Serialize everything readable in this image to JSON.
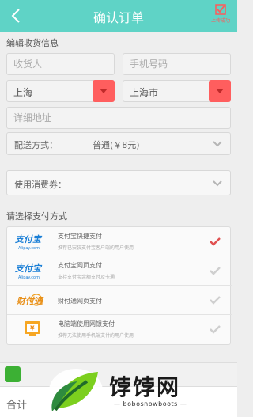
{
  "header": {
    "title": "确认订单",
    "upload_label": "上传成功"
  },
  "address": {
    "section_title": "编辑收货信息",
    "receiver_placeholder": "收货人",
    "phone_placeholder": "手机号码",
    "province": "上海",
    "city": "上海市",
    "detail_placeholder": "详细地址"
  },
  "delivery": {
    "label": "配送方式：",
    "value": "普通(￥8元)"
  },
  "voucher": {
    "label": "使用消费券："
  },
  "payment": {
    "section_title": "请选择支付方式",
    "methods": [
      {
        "logo": "支付宝",
        "logo_sub": "Alipay.com",
        "name": "支付宝快捷支付",
        "desc": "推荐已安装支付宝客户端的用户使用",
        "selected": true
      },
      {
        "logo": "支付宝",
        "logo_sub": "Alipay.com",
        "name": "支付宝网页支付",
        "desc": "支持支付宝余额支付及卡通",
        "selected": false
      },
      {
        "logo": "财付通",
        "logo_sub": "",
        "name": "财付通网页支付",
        "desc": "",
        "selected": false
      },
      {
        "logo": "¥",
        "logo_sub": "",
        "name": "电脑端使用网银支付",
        "desc": "推荐无法使用手机端支付的用户使用",
        "selected": false
      }
    ]
  },
  "footer": {
    "total_label": "合计"
  },
  "watermark": {
    "title": "饽饽网",
    "subtitle": "— bobosnowboots —"
  },
  "colors": {
    "header": "#5fd3c6",
    "accent": "#ff5e5e",
    "alipay": "#1b7fd6"
  }
}
